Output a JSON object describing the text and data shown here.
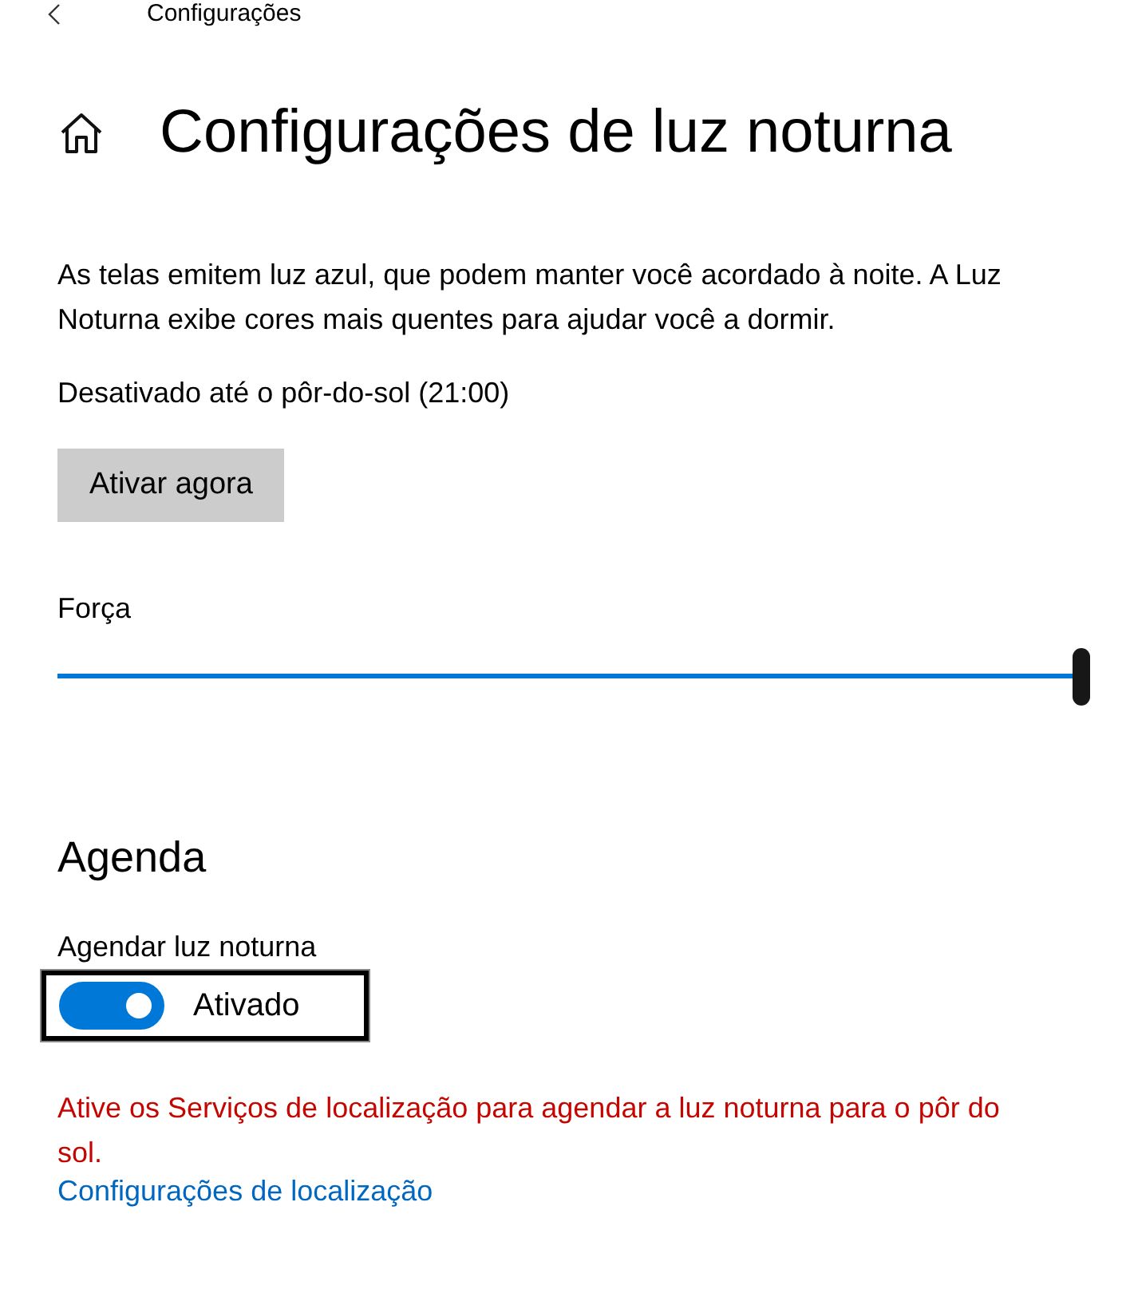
{
  "window": {
    "title": "Configurações"
  },
  "page": {
    "title": "Configurações de luz noturna"
  },
  "description": "As telas emitem luz azul, que podem manter você acordado à noite. A Luz Noturna exibe cores mais quentes para ajudar você a dormir.",
  "status": "Desativado até o pôr-do-sol (21:00)",
  "activate_button": "Ativar agora",
  "strength": {
    "label": "Força",
    "level": 1.0
  },
  "schedule": {
    "heading": "Agenda",
    "toggle_label": "Agendar luz noturna",
    "on": true,
    "state_text": "Ativado",
    "focused": true
  },
  "warning": "Ative os Serviços de localização para agendar a luz noturna para o pôr do sol.",
  "location_link": "Configurações de localização"
}
